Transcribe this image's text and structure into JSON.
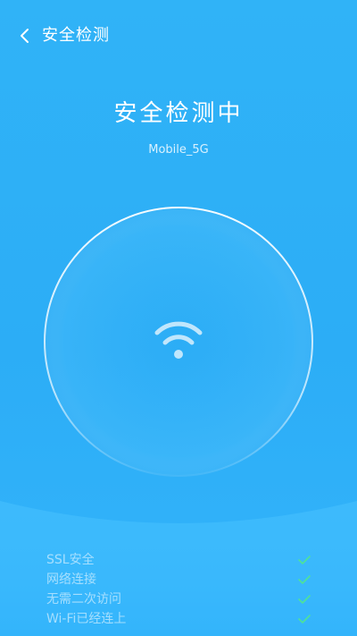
{
  "header": {
    "back_icon": "chevron-left-icon",
    "title": "安全检测"
  },
  "status": {
    "title": "安全检测中",
    "network_name": "Mobile_5G",
    "center_icon": "wifi-icon"
  },
  "checks": [
    {
      "label": "SSL安全",
      "status_icon": "check-icon"
    },
    {
      "label": "网络连接",
      "status_icon": "check-icon"
    },
    {
      "label": "无需二次访问",
      "status_icon": "check-icon"
    },
    {
      "label": "Wi-Fi已经连上",
      "status_icon": "check-icon"
    }
  ],
  "colors": {
    "background": "#2cadf6",
    "check_color": "#4ee29a"
  }
}
